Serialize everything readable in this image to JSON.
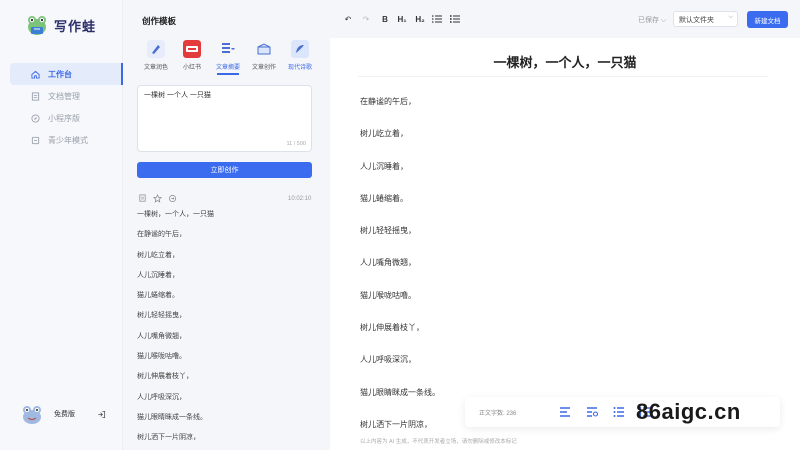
{
  "app": {
    "name": "写作蛙"
  },
  "nav": {
    "items": [
      {
        "label": "工作台",
        "icon": "home-icon",
        "active": true
      },
      {
        "label": "文档管理",
        "icon": "document-icon",
        "active": false
      },
      {
        "label": "小程序版",
        "icon": "compass-icon",
        "active": false
      },
      {
        "label": "青少年模式",
        "icon": "shield-icon",
        "active": false
      }
    ]
  },
  "user": {
    "name": "免费版"
  },
  "panel": {
    "title": "创作模板",
    "templates": [
      {
        "label": "文章润色",
        "icon": "brush-icon"
      },
      {
        "label": "小红书",
        "icon": "red-book-icon"
      },
      {
        "label": "文章摘要",
        "icon": "summary-icon"
      },
      {
        "label": "文章创作",
        "icon": "box-icon"
      },
      {
        "label": "现代诗歌",
        "icon": "poem-icon"
      }
    ],
    "input_value": "一棵树 一个人 一只猫",
    "char_count": "11 / 500",
    "create_button": "立即创作",
    "result_time": "10:02:10",
    "result_lines": [
      "一棵树，一个人，一只猫",
      "在静谧的午后，",
      "树儿屹立着，",
      "人儿沉睡着，",
      "猫儿蜷缩着。",
      "树儿轻轻摇曳，",
      "人儿嘴角微翘，",
      "猫儿喉咙咕噜。",
      "树儿伸展着枝丫，",
      "人儿呼吸深沉，",
      "猫儿眼睛眯成一条线。",
      "树儿洒下一片阴凉，"
    ]
  },
  "toolbar": {
    "undo": "↶",
    "redo": "↷",
    "bold": "B",
    "h1": "H₁",
    "h2": "H₂",
    "saved": "已保存",
    "folder": "默认文件夹",
    "new_doc": "新建文档"
  },
  "document": {
    "title": "一棵树，一个人，一只猫",
    "lines": [
      "在静谧的午后，",
      "树儿屹立着，",
      "人儿沉睡着，",
      "猫儿蜷缩着。",
      "树儿轻轻摇曳，",
      "人儿嘴角微翘，",
      "猫儿喉咙咕噜。",
      "树儿伸展着枝丫，",
      "人儿呼吸深沉，",
      "猫儿眼睛眯成一条线。",
      "树儿洒下一片阴凉，"
    ]
  },
  "bottom": {
    "word_count": "正文字数: 236",
    "disclaimer": "以上内容为 AI 生成，不代表开发者立场，请勿删除或修改本标记"
  },
  "watermark": "86aigc.cn",
  "colors": {
    "accent": "#3b6cf0",
    "sidebar_bg": "#f6f8fb",
    "active_bg": "#e4ebfb"
  }
}
